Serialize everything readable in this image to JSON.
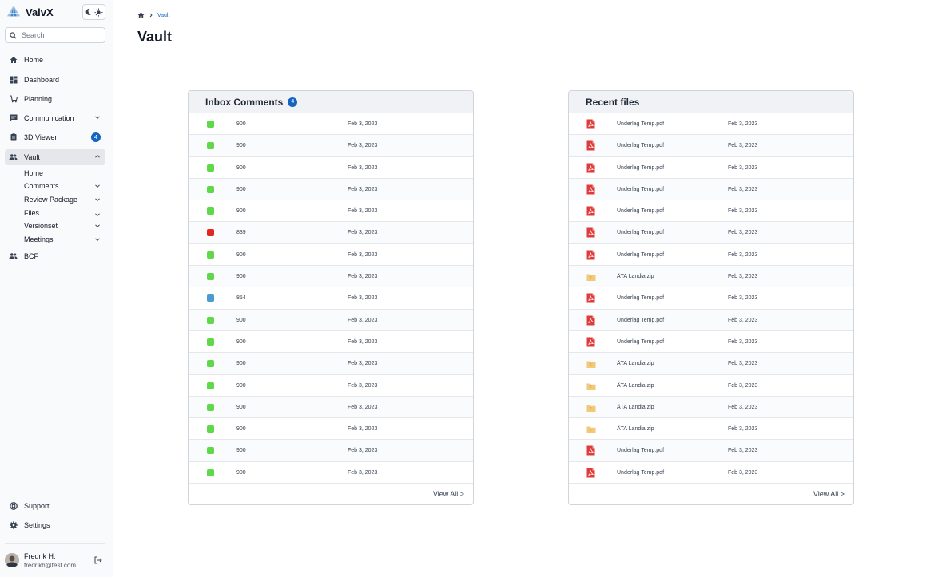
{
  "app": {
    "name": "ValvX"
  },
  "search": {
    "placeholder": "Search"
  },
  "nav": {
    "home": "Home",
    "dashboard": "Dashboard",
    "planning": "Planning",
    "communication": "Communication",
    "viewer": "3D Viewer",
    "viewer_badge": "4",
    "vault": "Vault",
    "bcf": "BCF",
    "support": "Support",
    "settings": "Settings"
  },
  "vault_sub": {
    "home": "Home",
    "comments": "Comments",
    "review": "Review Package",
    "files": "Files",
    "versionset": "Versionset",
    "meetings": "Meetings"
  },
  "user": {
    "name": "Fredrik H.",
    "email": "fredrikh@test.com"
  },
  "breadcrumb": {
    "current": "Vault"
  },
  "page": {
    "title": "Vault"
  },
  "inbox": {
    "title": "Inbox Comments",
    "count": "4",
    "view_all": "View All >",
    "rows": [
      {
        "status": "green",
        "code": "900",
        "date": "Feb 3, 2023"
      },
      {
        "status": "green",
        "code": "900",
        "date": "Feb 3, 2023"
      },
      {
        "status": "green",
        "code": "900",
        "date": "Feb 3, 2023"
      },
      {
        "status": "green",
        "code": "900",
        "date": "Feb 3, 2023"
      },
      {
        "status": "green",
        "code": "900",
        "date": "Feb 3, 2023"
      },
      {
        "status": "red",
        "code": "839",
        "date": "Feb 3, 2023"
      },
      {
        "status": "green",
        "code": "900",
        "date": "Feb 3, 2023"
      },
      {
        "status": "green",
        "code": "900",
        "date": "Feb 3, 2023"
      },
      {
        "status": "blue",
        "code": "854",
        "date": "Feb 3, 2023"
      },
      {
        "status": "green",
        "code": "900",
        "date": "Feb 3, 2023"
      },
      {
        "status": "green",
        "code": "900",
        "date": "Feb 3, 2023"
      },
      {
        "status": "green",
        "code": "900",
        "date": "Feb 3, 2023"
      },
      {
        "status": "green",
        "code": "900",
        "date": "Feb 3, 2023"
      },
      {
        "status": "green",
        "code": "900",
        "date": "Feb 3, 2023"
      },
      {
        "status": "green",
        "code": "900",
        "date": "Feb 3, 2023"
      },
      {
        "status": "green",
        "code": "900",
        "date": "Feb 3, 2023"
      },
      {
        "status": "green",
        "code": "900",
        "date": "Feb 3, 2023"
      }
    ]
  },
  "recent": {
    "title": "Recent files",
    "view_all": "View All >",
    "rows": [
      {
        "type": "pdf",
        "name": "Underlag Temp.pdf",
        "date": "Feb 3, 2023"
      },
      {
        "type": "pdf",
        "name": "Underlag Temp.pdf",
        "date": "Feb 3, 2023"
      },
      {
        "type": "pdf",
        "name": "Underlag Temp.pdf",
        "date": "Feb 3, 2023"
      },
      {
        "type": "pdf",
        "name": "Underlag Temp.pdf",
        "date": "Feb 3, 2023"
      },
      {
        "type": "pdf",
        "name": "Underlag Temp.pdf",
        "date": "Feb 3, 2023"
      },
      {
        "type": "pdf",
        "name": "Underlag Temp.pdf",
        "date": "Feb 3, 2023"
      },
      {
        "type": "pdf",
        "name": "Underlag Temp.pdf",
        "date": "Feb 3, 2023"
      },
      {
        "type": "zip",
        "name": "ÄTA Landia.zip",
        "date": "Feb 3, 2023"
      },
      {
        "type": "pdf",
        "name": "Underlag Temp.pdf",
        "date": "Feb 3, 2023"
      },
      {
        "type": "pdf",
        "name": "Underlag Temp.pdf",
        "date": "Feb 3, 2023"
      },
      {
        "type": "pdf",
        "name": "Underlag Temp.pdf",
        "date": "Feb 3, 2023"
      },
      {
        "type": "zip",
        "name": "ÄTA Landia.zip",
        "date": "Feb 3, 2023"
      },
      {
        "type": "zip",
        "name": "ÄTA Landia.zip",
        "date": "Feb 3, 2023"
      },
      {
        "type": "zip",
        "name": "ÄTA Landia.zip",
        "date": "Feb 3, 2023"
      },
      {
        "type": "zip",
        "name": "ÄTA Landia.zip",
        "date": "Feb 3, 2023"
      },
      {
        "type": "pdf",
        "name": "Underlag Temp.pdf",
        "date": "Feb 3, 2023"
      },
      {
        "type": "pdf",
        "name": "Underlag Temp.pdf",
        "date": "Feb 3, 2023"
      }
    ]
  },
  "colors": {
    "green": "#5fd94a",
    "red": "#e0281e",
    "blue": "#4a9bd1",
    "accent": "#1565c0",
    "pdf": "#e03b3b",
    "folder": "#f2c879"
  }
}
